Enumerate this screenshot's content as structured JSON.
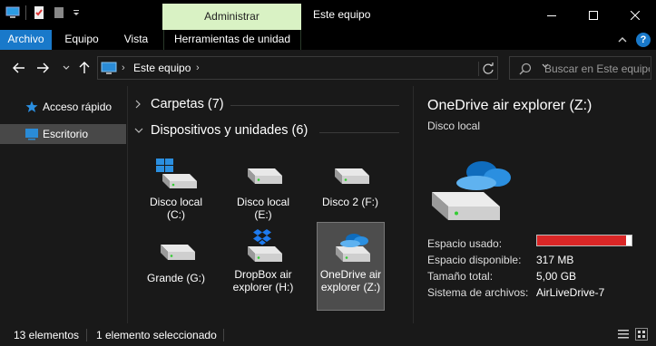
{
  "window": {
    "title": "Este equipo",
    "context_tab": "Administrar"
  },
  "ribbon": {
    "tabs": [
      "Archivo",
      "Equipo",
      "Vista",
      "Herramientas de unidad"
    ]
  },
  "address": {
    "crumbs": [
      "Este equipo"
    ],
    "search_placeholder": "Buscar en Este equipo"
  },
  "sidebar": {
    "items": [
      {
        "label": "Acceso rápido",
        "icon": "star-icon"
      },
      {
        "label": "Escritorio",
        "icon": "desktop-icon",
        "selected": true
      }
    ]
  },
  "main": {
    "groups": [
      {
        "label": "Carpetas (7)",
        "expanded": false
      },
      {
        "label": "Dispositivos y unidades (6)",
        "expanded": true
      }
    ],
    "drives": [
      {
        "label": "Disco local (C:)",
        "icon": "windows-drive-icon"
      },
      {
        "label": "Disco local (E:)",
        "icon": "drive-icon"
      },
      {
        "label": "Disco 2 (F:)",
        "icon": "drive-icon"
      },
      {
        "label": "Grande (G:)",
        "icon": "drive-icon"
      },
      {
        "label": "DropBox air explorer (H:)",
        "icon": "dropbox-drive-icon"
      },
      {
        "label": "OneDrive air explorer (Z:)",
        "icon": "onedrive-drive-icon",
        "selected": true
      }
    ]
  },
  "details": {
    "title": "OneDrive air explorer (Z:)",
    "subtitle": "Disco local",
    "properties": [
      {
        "label": "Espacio usado:",
        "value": ""
      },
      {
        "label": "Espacio disponible:",
        "value": "317 MB"
      },
      {
        "label": "Tamaño total:",
        "value": "5,00 GB"
      },
      {
        "label": "Sistema de archivos:",
        "value": "AirLiveDrive-7"
      }
    ],
    "usage_fraction": 0.94,
    "usage_color": "#da2626"
  },
  "status": {
    "items_count": "13 elementos",
    "selected": "1 elemento seleccionado"
  },
  "colors": {
    "accent": "#1979ca",
    "context_tab_bg": "#d9f2c4",
    "background": "#191919"
  }
}
